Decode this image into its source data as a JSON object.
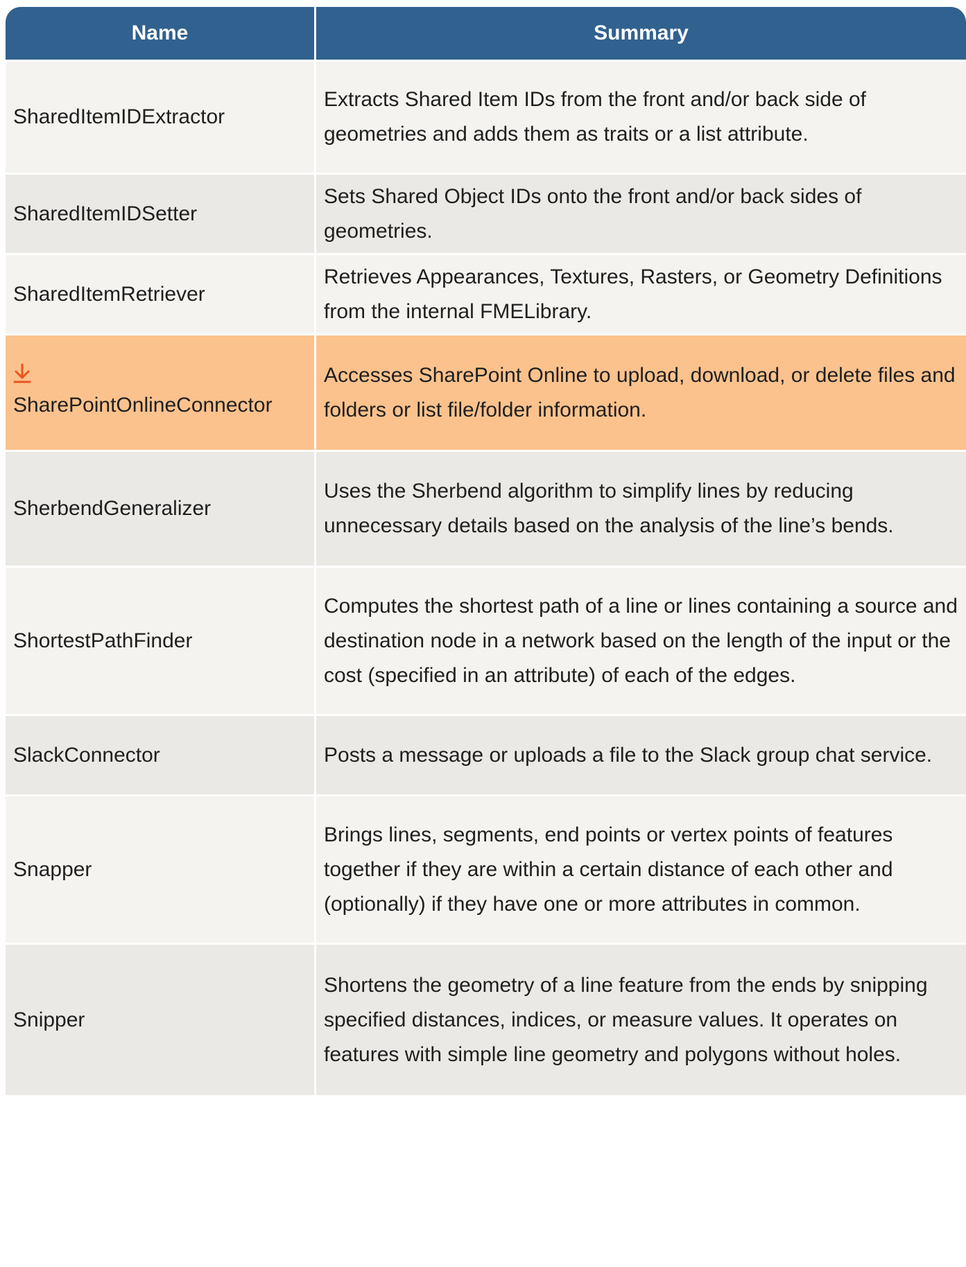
{
  "table": {
    "headers": {
      "name": "Name",
      "summary": "Summary"
    },
    "accent_header_color": "#31618f",
    "highlight_color": "#fcc28d",
    "download_icon_color": "#e8541e",
    "rows": [
      {
        "name": "SharedItemIDExtractor",
        "summary": "Extracts Shared Item IDs from the front and/or back side of geometries and adds them as traits or a list attribute."
      },
      {
        "name": "SharedItemIDSetter",
        "summary": "Sets Shared Object IDs onto the front and/or back sides of geometries."
      },
      {
        "name": "SharedItemRetriever",
        "summary": "Retrieves Appearances, Textures, Rasters, or Geometry Definitions from the internal FMELibrary."
      },
      {
        "name": "SharePointOnlineConnector",
        "summary": "Accesses SharePoint Online to upload, download, or delete files and folders or list file/folder information.",
        "icon": "download-icon",
        "highlighted": true
      },
      {
        "name": "SherbendGeneralizer",
        "summary": "Uses the Sherbend algorithm to simplify lines by reducing unnecessary details based on the analysis of the line’s bends."
      },
      {
        "name": "ShortestPathFinder",
        "summary": "Computes the shortest path of a line or lines containing a source and destination node in a network based on the length of the input or the cost (specified in an attribute) of each of the edges."
      },
      {
        "name": "SlackConnector",
        "summary": "Posts a message or uploads a file to the Slack group chat service."
      },
      {
        "name": "Snapper",
        "summary": "Brings lines, segments, end points or vertex points of features together if they are within a certain distance of each other and (optionally) if they have one or more attributes in common."
      },
      {
        "name": "Snipper",
        "summary": "Shortens the geometry of a line feature from the ends by snipping specified distances, indices, or measure values. It operates on features with simple line geometry and polygons without holes."
      }
    ]
  }
}
